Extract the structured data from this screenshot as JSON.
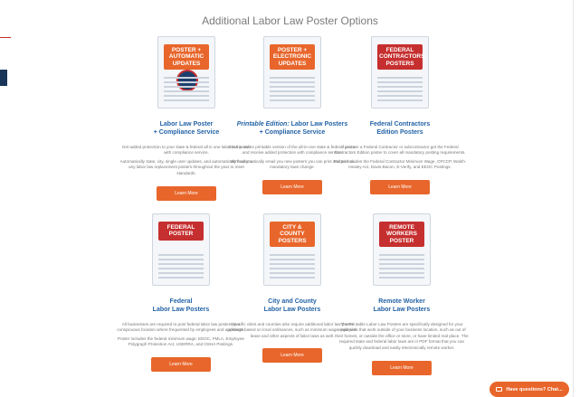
{
  "section": {
    "title": "Additional Labor Law Poster Options"
  },
  "cards": [
    {
      "poster": {
        "tag_text": "Poster + Automatic Updates",
        "tag_color": "#e8662b",
        "icon": "seal-icon"
      },
      "title_prefix": "",
      "title_line1": "Labor Law Poster",
      "title_line2": "+ Compliance Service",
      "desc_p1": "Get added protection to your state & federal all in one labor law poster with compliance service.",
      "desc_p2": "Automatically state, city, single user updates, and automatically mail you any labor law replacement posters throughout the year to meet standards.",
      "button": "Learn More"
    },
    {
      "poster": {
        "tag_text": "Poster + Electronic Updates",
        "tag_color": "#e8662b"
      },
      "title_prefix": "Printable Edition:",
      "title_line1": "Labor Law Posters",
      "title_line2": "+ Compliance Service",
      "desc_p1": "Get the online printable version of the all-in-one state & federal poster and receive added protection with compliance service.",
      "desc_p2": "We'll automatically email you new posters you can print and post as mandatory laws change.",
      "button": "Learn More"
    },
    {
      "poster": {
        "tag_text": "Federal Contractors Posters",
        "tag_color": "#c62f2f"
      },
      "title_prefix": "",
      "title_line1": "Federal Contractors",
      "title_line2": "Edition Posters",
      "desc_p1": "If you are a Federal Contractor or subcontractor get the Federal Contractors Edition poster to cover all mandatory posting requirements.",
      "desc_p2": "Poster includes the Federal Contractor Minimum Wage, OFCCP, Walsh-Healey Act, Davis-Bacon, E-Verify, and EEOC Postings.",
      "button": "Learn More"
    },
    {
      "poster": {
        "tag_text": "Federal Poster",
        "tag_color": "#c62f2f"
      },
      "title_prefix": "",
      "title_line1": "Federal",
      "title_line2": "Labor Law Posters",
      "desc_p1": "All businesses are required to post federal labor law posters in a conspicuous location where frequented by employees and applicants.",
      "desc_p2": "Poster includes the federal minimum wage, EEOC, FMLA, Employee Polygraph Protection Act, USERRA, and OSHA Postings.",
      "button": "Learn More"
    },
    {
      "poster": {
        "tag_text": "City & County Posters",
        "tag_color": "#e8662b"
      },
      "title_prefix": "",
      "title_line1": "City and County",
      "title_line2": "Labor Law Posters",
      "desc_p1": "Specific cities and counties also require additional labor law poster postings based on local ordinances, such as minimum wage, paid sick leave and other aspects of labor laws as well.",
      "desc_p2": "",
      "button": "Learn More"
    },
    {
      "poster": {
        "tag_text": "Remote Workers Poster",
        "tag_color": "#c62f2f"
      },
      "title_prefix": "",
      "title_line1": "Remote Worker",
      "title_line2": "Labor Law Posters",
      "desc_p1": "The Printable Labor Law Posters are specifically designed for your employees that work outside of your business location, such as out of their homes, or outside the office or store, or have limited real place. The required state and federal labor laws are in PDF format that you can quickly download and easily electronically remote worker.",
      "desc_p2": "",
      "button": "Learn More"
    }
  ],
  "chat": {
    "label": "Have questions? Chat...",
    "icon": "chat-icon"
  },
  "colors": {
    "accent": "#e8662b",
    "title_blue": "#2463a6",
    "red": "#c62f2f",
    "navy": "#1a3557"
  }
}
